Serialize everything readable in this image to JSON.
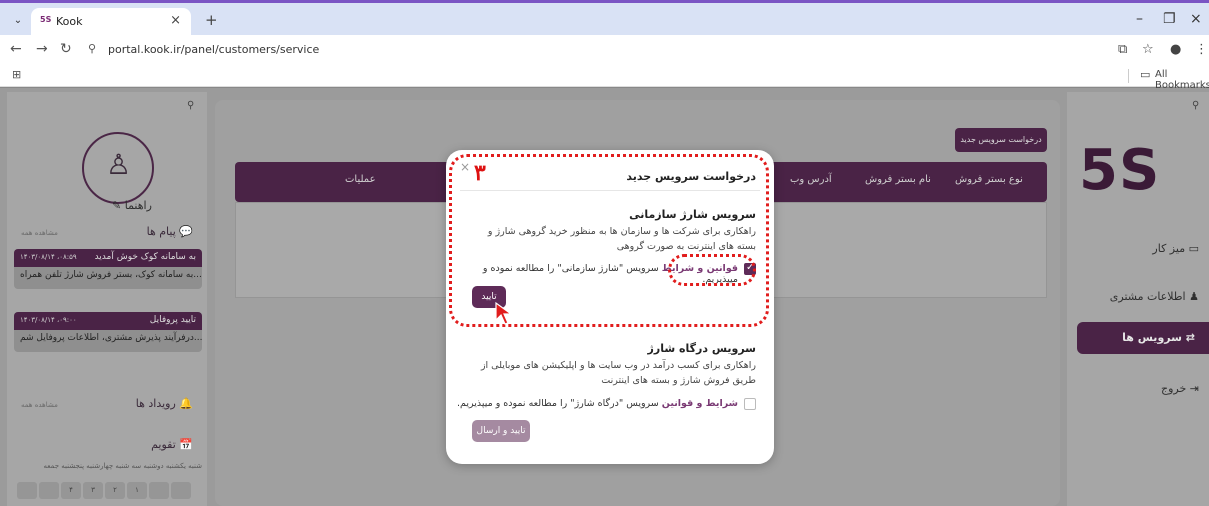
{
  "browser": {
    "tab_title": "Kook",
    "favicon": "5S",
    "url": "portal.kook.ir/panel/customers/service",
    "bookmarks_label": "All Bookmarks"
  },
  "sidebar_left": {
    "guide_label": "راهنما",
    "messages": {
      "title": "پیام ها",
      "view_all": "مشاهده همه",
      "items": [
        {
          "date": "۱۴۰۳/۰۸/۱۴ ،۰۸:۵۹",
          "title": "به سامانه کوک خوش آمدید",
          "body": "به سامانه کوک، بستر فروش شارژ تلفن همراه..."
        },
        {
          "date": "۱۴۰۳/۰۸/۱۴ ،۰۹:۰۰",
          "title": "تایید پروفایل",
          "body": "درفرآیند پذیرش مشتری، اطلاعات پروفایل شم..."
        }
      ]
    },
    "events": {
      "title": "رویداد ها",
      "view_all": "مشاهده همه"
    },
    "calendar": {
      "title": "تقویم",
      "days": "شنبه   یکشنبه   دوشنبه   سه شنبه   چهارشنبه   پنجشنبه   جمعه",
      "cells": [
        "۱",
        "۲",
        "۳",
        "۴"
      ]
    }
  },
  "sidebar_right": {
    "menu": [
      {
        "label": "میز کار"
      },
      {
        "label": "اطلاعات مشتری"
      },
      {
        "label": "سرویس ها"
      },
      {
        "label": "خروج"
      }
    ]
  },
  "main": {
    "request_button": "درخواست سرویس جدید",
    "columns": [
      "نوع بستر فروش",
      "نام بستر فروش",
      "آدرس وب",
      "عملیات"
    ]
  },
  "modal": {
    "title": "درخواست سرویس جدید",
    "close": "×",
    "service1": {
      "heading": "سرویس شارژ سازمانی",
      "description": "راهکاری برای شرکت ها و سازمان ها به منظور خرید گروهی شارژ و بسته های اینترنت به صورت گروهی",
      "terms_link": "قوانین و شرایط",
      "agree_text": "سرویس \"شارژ سازمانی\" را مطالعه نموده و میپذیریم.",
      "checked": true,
      "button": "تایید"
    },
    "service2": {
      "heading": "سرویس درگاه شارژ",
      "description": "راهکاری برای کسب درآمد در وب سایت ها و اپلیکیشن های موبایلی از طریق فروش شارژ و بسته های اینترنت",
      "terms_link": "شرایط و قوانین",
      "agree_text": "سرویس \"درگاه شارژ\" را مطالعه نموده و میپذیریم.",
      "checked": false,
      "button": "تایید و ارسال"
    }
  },
  "annotation": {
    "step": "۳",
    "color": "#e11d1d"
  },
  "colors": {
    "brand": "#4a2346",
    "accent": "#5e2b58"
  }
}
